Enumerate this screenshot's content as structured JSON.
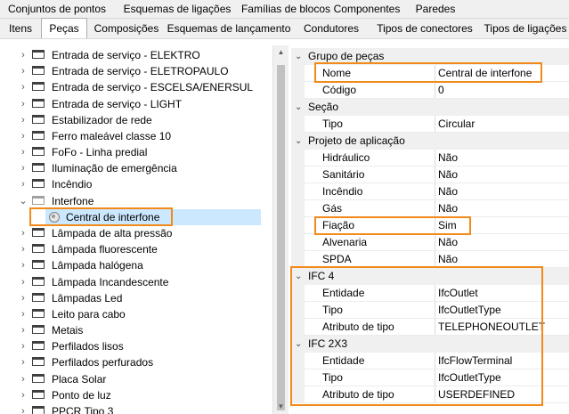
{
  "tabs_top": [
    "Conjuntos de pontos",
    "Esquemas de ligações",
    "Famílias de blocos",
    "Componentes",
    "Paredes"
  ],
  "tabs_second": [
    "Itens",
    "Peças",
    "Composições",
    "Esquemas de lançamento",
    "Condutores",
    "Tipos de conectores",
    "Tipos de ligações"
  ],
  "active_tab": "Peças",
  "tree": {
    "items": [
      "Entrada de serviço - ELEKTRO",
      "Entrada de serviço - ELETROPAULO",
      "Entrada de serviço - ESCELSA/ENERSUL",
      "Entrada de serviço - LIGHT",
      "Estabilizador de rede",
      "Ferro maleável classe 10",
      "FoFo - Linha predial",
      "Iluminação de emergência",
      "Incêndio",
      "Interfone",
      "Central de interfone",
      "Lâmpada de alta pressão",
      "Lâmpada fluorescente",
      "Lâmpada halógena",
      "Lâmpada Incandescente",
      "Lâmpadas Led",
      "Leito para cabo",
      "Metais",
      "Perfilados lisos",
      "Perfilados perfurados",
      "Placa Solar",
      "Ponto de luz",
      "PPCR Tipo 3"
    ]
  },
  "properties": {
    "grupo": {
      "title": "Grupo de peças",
      "nome_label": "Nome",
      "nome_value": "Central de interfone",
      "codigo_label": "Código",
      "codigo_value": "0"
    },
    "secao": {
      "title": "Seção",
      "tipo_label": "Tipo",
      "tipo_value": "Circular"
    },
    "projeto": {
      "title": "Projeto de aplicação",
      "rows": [
        {
          "label": "Hidráulico",
          "value": "Não"
        },
        {
          "label": "Sanitário",
          "value": "Não"
        },
        {
          "label": "Incêndio",
          "value": "Não"
        },
        {
          "label": "Gás",
          "value": "Não"
        },
        {
          "label": "Fiação",
          "value": "Sim"
        },
        {
          "label": "Alvenaria",
          "value": "Não"
        },
        {
          "label": "SPDA",
          "value": "Não"
        }
      ]
    },
    "ifc4": {
      "title": "IFC 4",
      "rows": [
        {
          "label": "Entidade",
          "value": "IfcOutlet"
        },
        {
          "label": "Tipo",
          "value": "IfcOutletType"
        },
        {
          "label": "Atributo de tipo",
          "value": "TELEPHONEOUTLET"
        }
      ]
    },
    "ifc2x3": {
      "title": "IFC 2X3",
      "rows": [
        {
          "label": "Entidade",
          "value": "IfcFlowTerminal"
        },
        {
          "label": "Tipo",
          "value": "IfcOutletType"
        },
        {
          "label": "Atributo de tipo",
          "value": "USERDEFINED"
        }
      ]
    }
  },
  "highlight_color": "#f28a1a",
  "selection_color": "#cce8ff"
}
